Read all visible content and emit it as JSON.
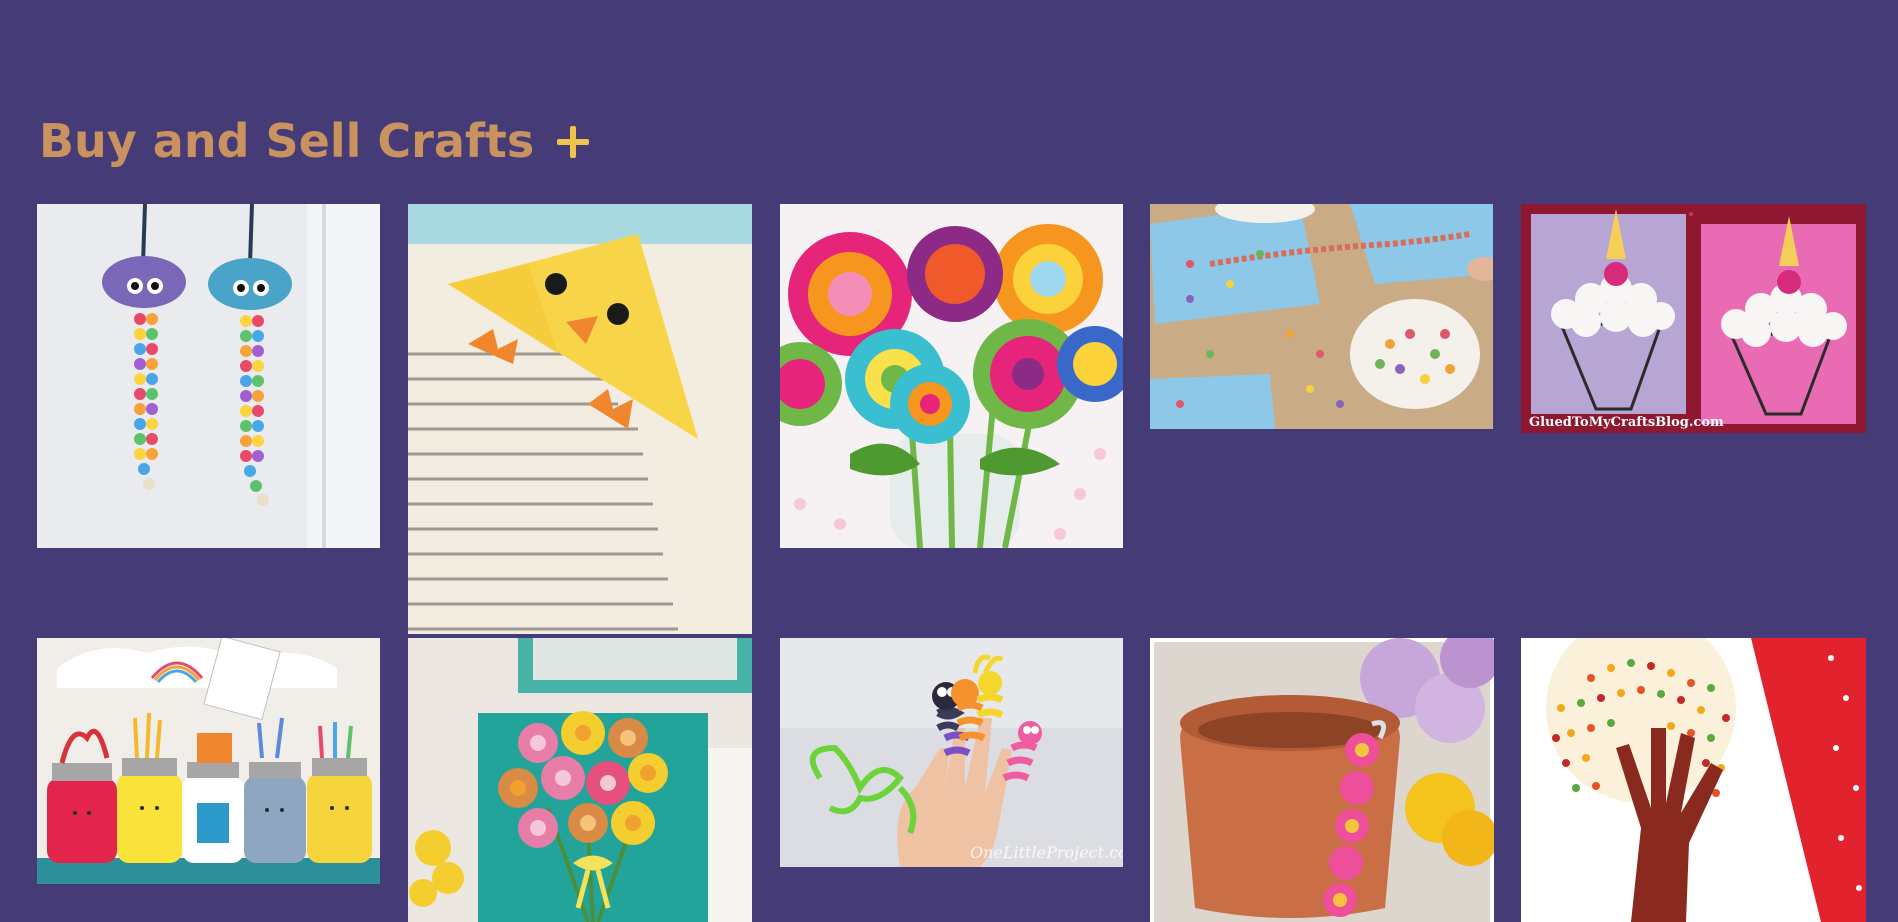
{
  "header": {
    "title": "Buy and Sell Crafts",
    "add_icon": "plus-icon"
  },
  "colors": {
    "background": "#453c77",
    "title": "#c9925f",
    "accent": "#f0c24e"
  },
  "gallery": {
    "items": [
      {
        "image": "egg-carton-jellyfish-craft",
        "watermark": ""
      },
      {
        "image": "chick-corner-bookmark-craft",
        "watermark": ""
      },
      {
        "image": "felt-button-flower-bouquet",
        "watermark": ""
      },
      {
        "image": "cereal-loop-necklace-activity",
        "watermark": ""
      },
      {
        "image": "cotton-ball-unicorn-cupcake-cards",
        "watermark": "GluedToMyCraftsBlog.com"
      },
      {
        "image": "painted-mason-jar-pencil-holders",
        "watermark": ""
      },
      {
        "image": "egg-carton-flower-canvas",
        "watermark": ""
      },
      {
        "image": "pipe-cleaner-finger-puppets",
        "watermark": "OneLittleProject.com"
      },
      {
        "image": "ribbon-flower-clay-pot",
        "watermark": ""
      },
      {
        "image": "handprint-fingerprint-tree-art",
        "watermark": ""
      }
    ]
  }
}
